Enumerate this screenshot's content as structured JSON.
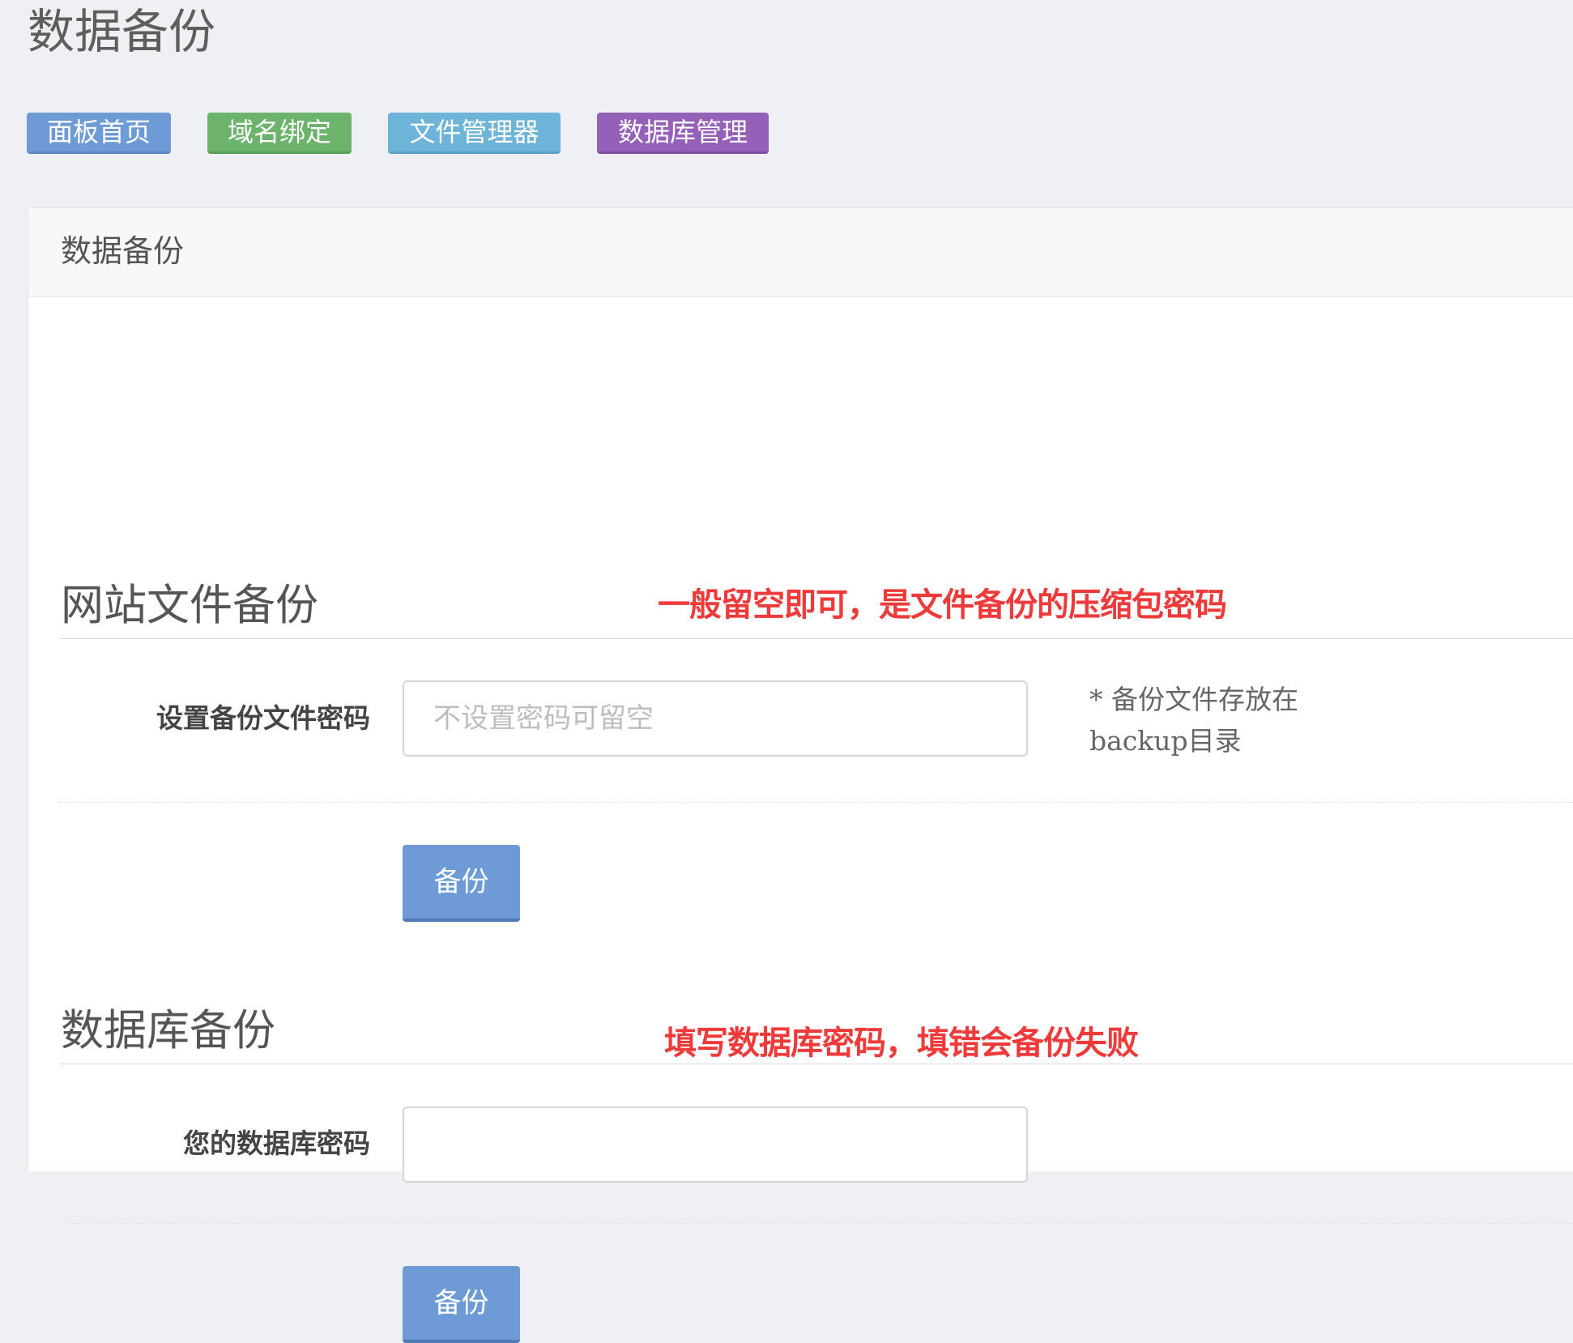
{
  "page": {
    "title": "数据备份"
  },
  "nav": {
    "items": [
      {
        "label": "面板首页",
        "color": "#6e9ad6"
      },
      {
        "label": "域名绑定",
        "color": "#6cb46c"
      },
      {
        "label": "文件管理器",
        "color": "#6eb4d9"
      },
      {
        "label": "数据库管理",
        "color": "#9561b8"
      }
    ]
  },
  "panel": {
    "title": "数据备份"
  },
  "file_backup": {
    "title": "网站文件备份",
    "annotation": "一般留空即可，是文件备份的压缩包密码",
    "password_label": "设置备份文件密码",
    "password_value": "",
    "password_placeholder": "不设置密码可留空",
    "help_text": "* 备份文件存放在backup目录",
    "button_label": "备份"
  },
  "db_backup": {
    "title": "数据库备份",
    "annotation": "填写数据库密码，填错会备份失败",
    "password_label": "您的数据库密码",
    "password_value": "",
    "password_placeholder": "",
    "button_label": "备份"
  },
  "colors": {
    "annotation_red": "#ee3a3a",
    "primary_button": "#6e9ad6",
    "page_background": "#eef0f4"
  }
}
